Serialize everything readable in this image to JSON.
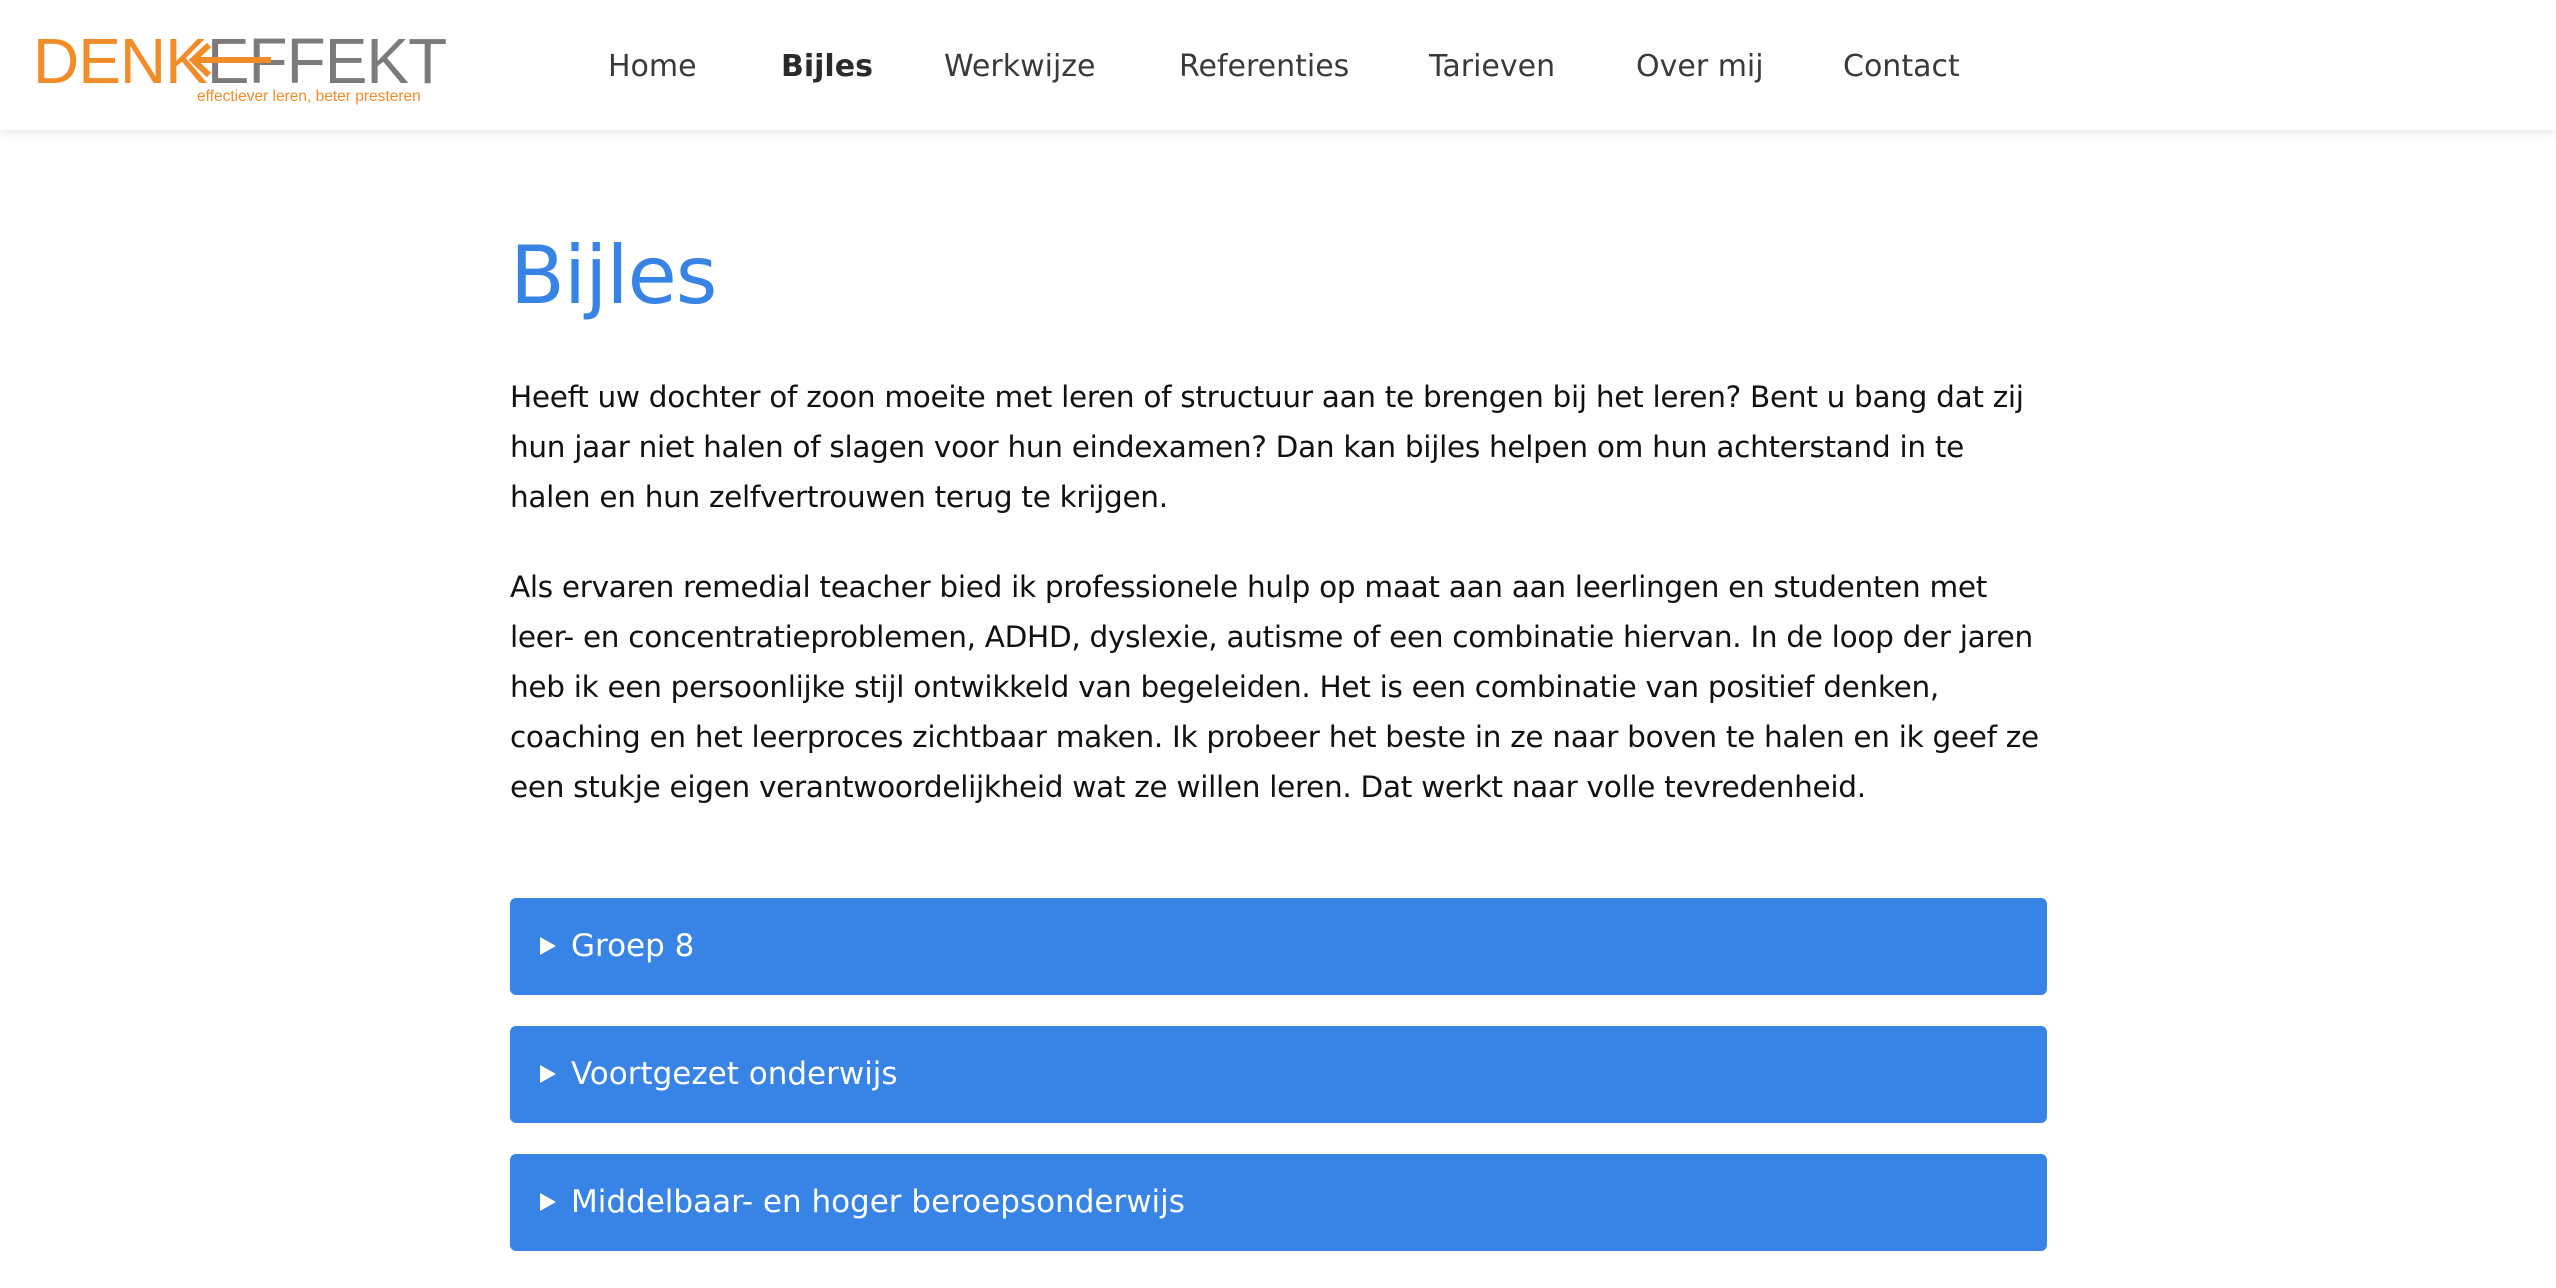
{
  "header": {
    "logo": {
      "part1": "DENK",
      "part2": "EFFEKT",
      "tagline": "effectiever leren, beter presteren"
    },
    "nav": [
      {
        "label": "Home",
        "active": false
      },
      {
        "label": "Bijles",
        "active": true
      },
      {
        "label": "Werkwijze",
        "active": false
      },
      {
        "label": "Referenties",
        "active": false
      },
      {
        "label": "Tarieven",
        "active": false
      },
      {
        "label": "Over mij",
        "active": false
      },
      {
        "label": "Contact",
        "active": false
      }
    ]
  },
  "main": {
    "title": "Bijles",
    "paragraphs": [
      "Heeft uw dochter of zoon moeite met leren of structuur aan te brengen bij het leren? Bent u bang dat zij hun jaar niet halen of slagen voor hun eindexamen? Dan kan bijles helpen om hun achterstand in te halen en hun zelfvertrouwen terug te krijgen.",
      "Als ervaren remedial teacher bied ik professionele hulp op maat aan aan leerlingen en studenten met leer- en concentratieproblemen, ADHD, dyslexie, autisme of een combinatie hiervan. In de loop der jaren heb ik een persoonlijke stijl ontwikkeld van begeleiden. Het is een combinatie van positief denken, coaching en het leerproces zichtbaar maken. Ik probeer het beste in ze naar boven te halen en ik geef ze een stukje eigen verantwoordelijkheid wat ze willen leren. Dat werkt naar volle tevredenheid."
    ],
    "accordions": [
      {
        "label": "Groep 8",
        "expanded": false
      },
      {
        "label": "Voortgezet onderwijs",
        "expanded": false
      },
      {
        "label": "Middelbaar- en hoger beroepsonderwijs",
        "expanded": false
      }
    ]
  },
  "colors": {
    "brand_orange": "#f28c28",
    "brand_gray": "#7b7b7b",
    "accent_blue": "#3784e6",
    "text": "#111111"
  },
  "icons": {
    "accordion": "triangle-right-icon",
    "logo_arrow": "arrow-left-icon"
  }
}
